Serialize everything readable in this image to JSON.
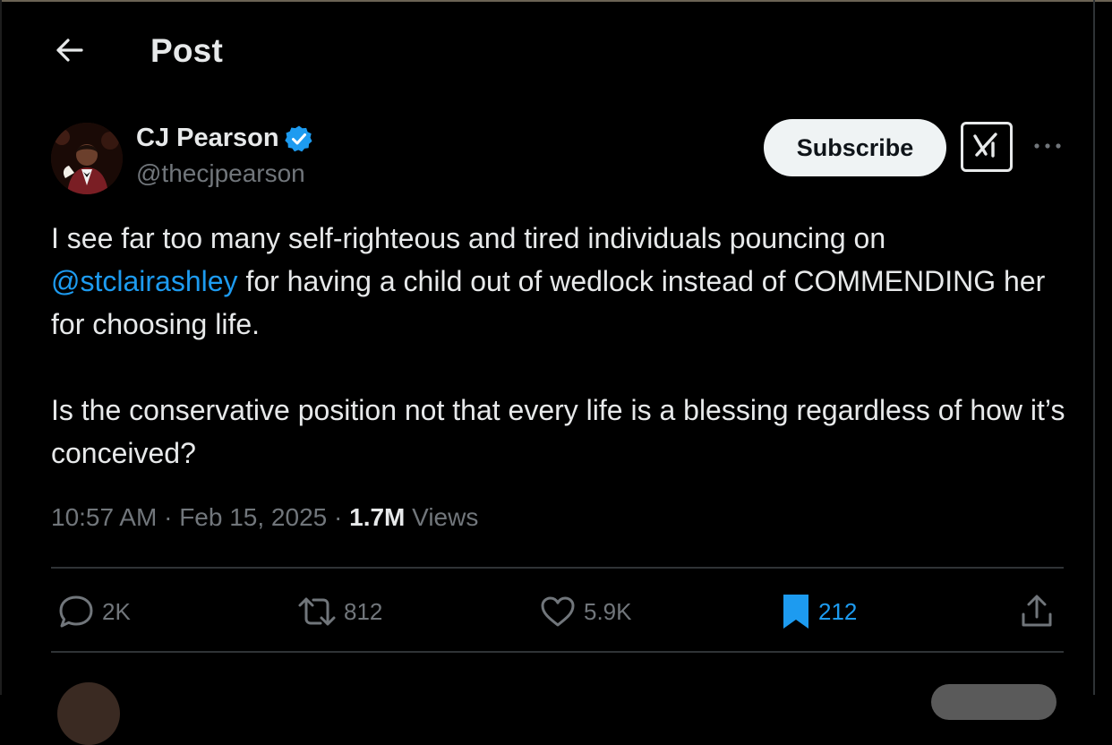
{
  "header": {
    "title": "Post",
    "back_icon": "arrow-left-icon"
  },
  "author": {
    "name": "CJ Pearson",
    "handle": "@thecjpearson",
    "verified": true,
    "verified_color": "#1d9bf0"
  },
  "actions_top": {
    "subscribe_label": "Subscribe",
    "grok_icon": "grok-icon",
    "more_icon": "more-horizontal-icon"
  },
  "post": {
    "para1_before": "I see far too many self-righteous and tired individuals pouncing on ",
    "mention": "@stclairashley",
    "para1_after": " for having a child out of wedlock instead of COMMENDING her for choosing life.",
    "para2": "Is the conservative position not that every life is a blessing regardless of how it’s conceived?"
  },
  "meta": {
    "time": "10:57 AM",
    "sep1": " · ",
    "date": "Feb 15, 2025",
    "sep2": " · ",
    "views_count": "1.7M",
    "views_label": " Views"
  },
  "engagement": {
    "replies": "2K",
    "reposts": "812",
    "likes": "5.9K",
    "bookmarks": "212",
    "bookmarked": true
  },
  "colors": {
    "background": "#000000",
    "text": "#e7e9ea",
    "muted": "#71767b",
    "accent": "#1d9bf0",
    "divider": "#2f3336"
  }
}
